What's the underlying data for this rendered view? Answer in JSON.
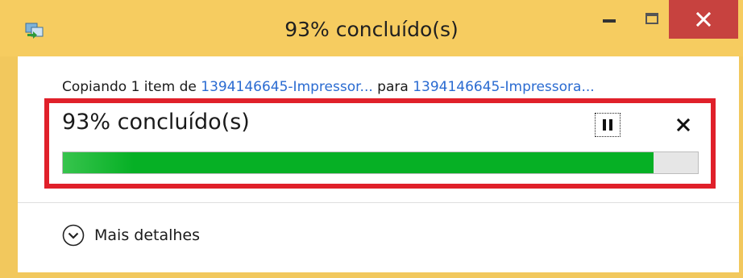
{
  "window": {
    "title": "93% concluído(s)",
    "accent_color": "#f6cc60",
    "close_color": "#c7423f"
  },
  "copy": {
    "prefix": "Copiando 1 item de ",
    "source": "1394146645-Impressor...",
    "middle": " para ",
    "destination": "1394146645-Impressora..."
  },
  "progress": {
    "status_text": "93% concluído(s)",
    "percent": 93,
    "fill_color": "#06b025"
  },
  "controls": {
    "pause_icon": "pause-icon",
    "cancel_icon": "close-icon"
  },
  "details": {
    "label": "Mais detalhes",
    "icon": "chevron-down-icon"
  }
}
